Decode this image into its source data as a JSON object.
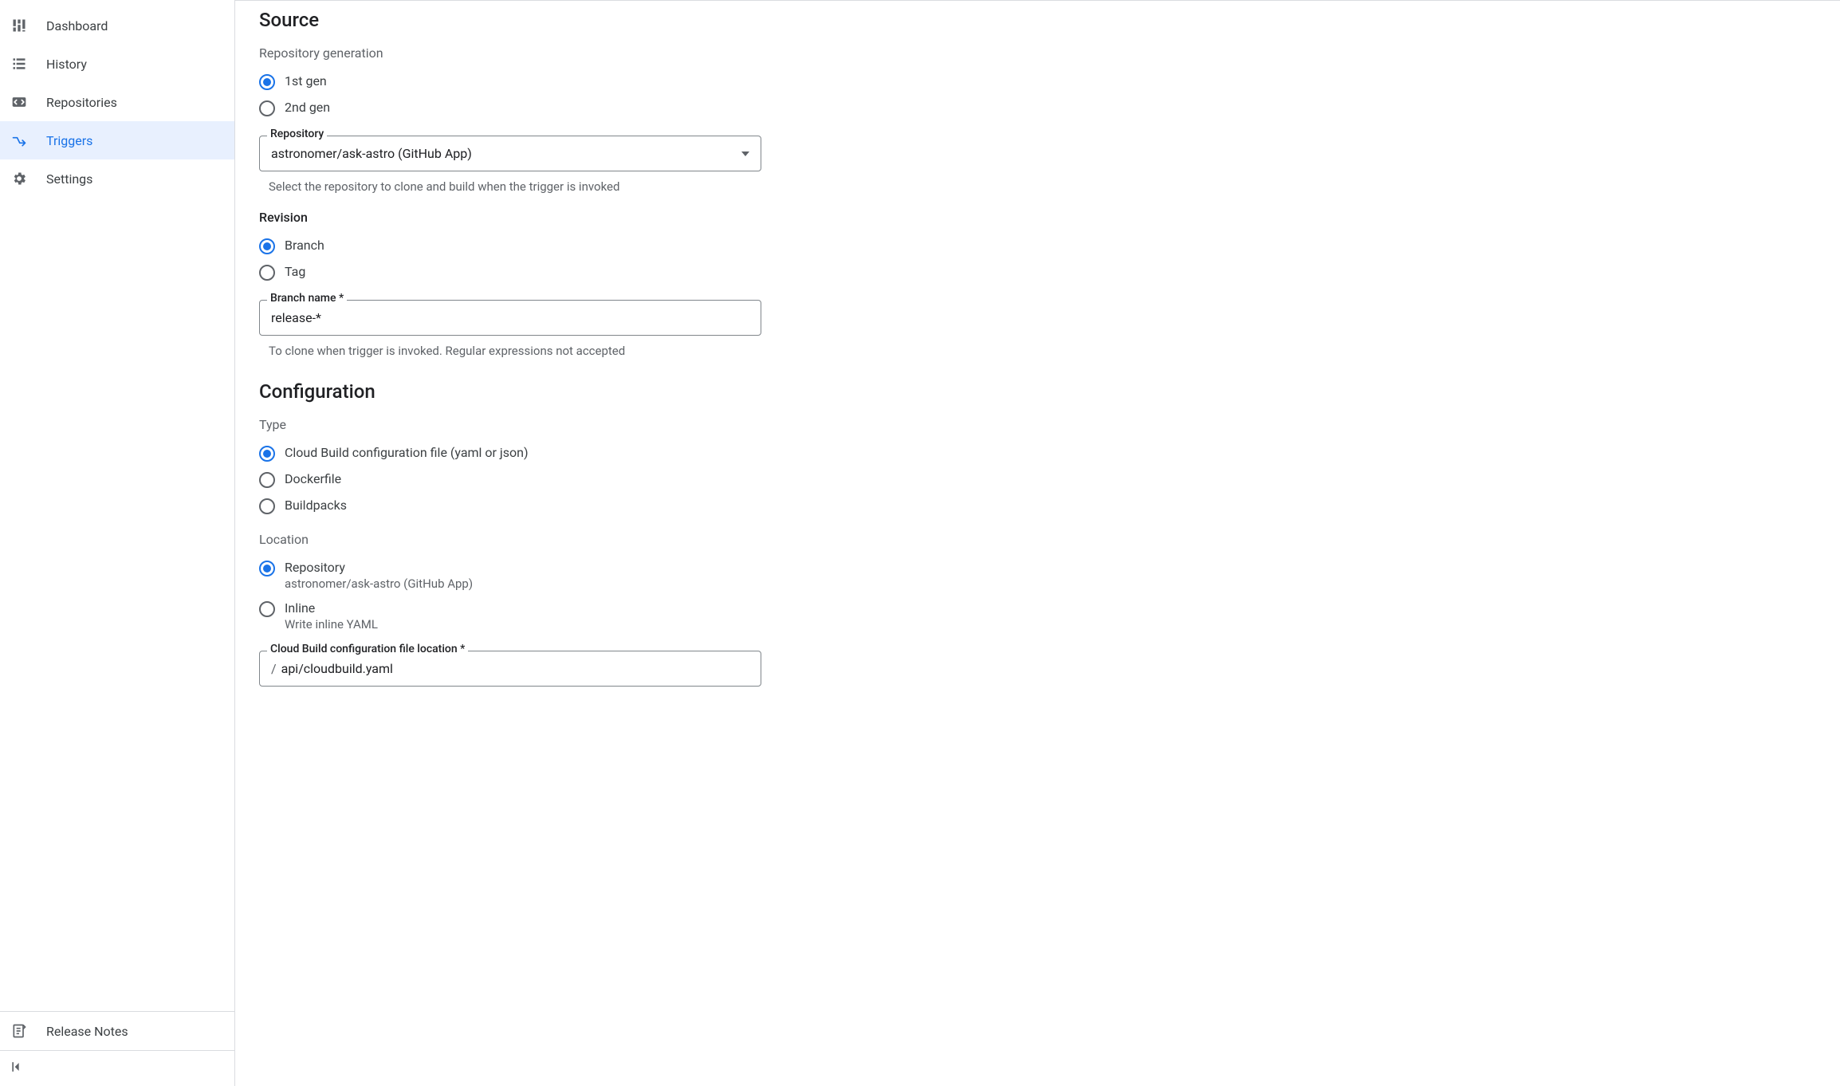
{
  "sidebar": {
    "items": [
      {
        "label": "Dashboard"
      },
      {
        "label": "History"
      },
      {
        "label": "Repositories"
      },
      {
        "label": "Triggers"
      },
      {
        "label": "Settings"
      }
    ],
    "release_notes": "Release Notes"
  },
  "source": {
    "heading": "Source",
    "repo_gen_label": "Repository generation",
    "gen_options": [
      "1st gen",
      "2nd gen"
    ],
    "gen_selected": 0,
    "repo_field_label": "Repository",
    "repo_value": "astronomer/ask-astro (GitHub App)",
    "repo_helper": "Select the repository to clone and build when the trigger is invoked",
    "revision_heading": "Revision",
    "revision_options": [
      "Branch",
      "Tag"
    ],
    "revision_selected": 0,
    "branch_field_label": "Branch name *",
    "branch_value": "release-*",
    "branch_helper": "To clone when trigger is invoked. Regular expressions not accepted"
  },
  "configuration": {
    "heading": "Configuration",
    "type_label": "Type",
    "type_options": [
      "Cloud Build configuration file (yaml or json)",
      "Dockerfile",
      "Buildpacks"
    ],
    "type_selected": 0,
    "location_label": "Location",
    "location_options": [
      {
        "label": "Repository",
        "sublabel": "astronomer/ask-astro (GitHub App)"
      },
      {
        "label": "Inline",
        "sublabel": "Write inline YAML"
      }
    ],
    "location_selected": 0,
    "file_location_label": "Cloud Build configuration file location *",
    "file_location_prefix": "/",
    "file_location_value": "api/cloudbuild.yaml"
  }
}
